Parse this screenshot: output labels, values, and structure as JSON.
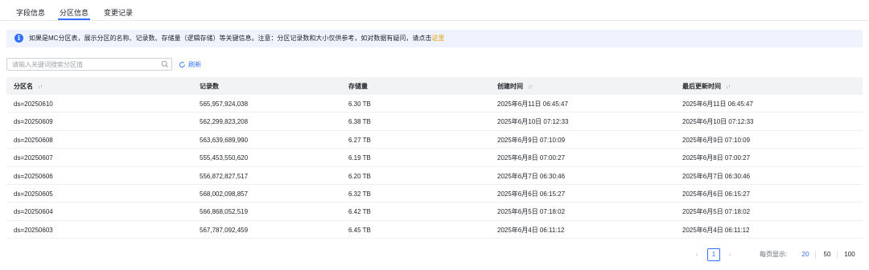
{
  "tabs": [
    {
      "label": "字段信息"
    },
    {
      "label": "分区信息"
    },
    {
      "label": "变更记录"
    }
  ],
  "notice": {
    "icon": "info-icon",
    "text": "如果是MC分区表，展示分区的名称、记录数、存储量（逻辑存储）等关键信息。注意：分区记录数和大小仅供参考，如对数据有疑问，请点击",
    "link": "这里"
  },
  "search": {
    "placeholder": "请输入关键词搜索分区值",
    "value": ""
  },
  "refresh_label": "刷新",
  "table": {
    "columns": [
      "分区名",
      "记录数",
      "存储量",
      "创建时间",
      "最后更新时间"
    ],
    "rows": [
      [
        "ds=20250610",
        "565,957,924,038",
        "6.30 TB",
        "2025年6月11日 06:45:47",
        "2025年6月11日 06:45:47"
      ],
      [
        "ds=20250609",
        "562,299,823,208",
        "6.38 TB",
        "2025年6月10日 07:12:33",
        "2025年6月10日 07:12:33"
      ],
      [
        "ds=20250608",
        "563,639,689,990",
        "6.27 TB",
        "2025年6月9日 07:10:09",
        "2025年6月9日 07:10:09"
      ],
      [
        "ds=20250607",
        "555,453,550,620",
        "6.19 TB",
        "2025年6月8日 07:00:27",
        "2025年6月8日 07:00:27"
      ],
      [
        "ds=20250606",
        "556,872,827,517",
        "6.20 TB",
        "2025年6月7日 06:30:46",
        "2025年6月7日 06:30:46"
      ],
      [
        "ds=20250605",
        "568,002,098,857",
        "6.32 TB",
        "2025年6月6日 06:15:27",
        "2025年6月6日 06:15:27"
      ],
      [
        "ds=20250604",
        "566,868,052,519",
        "6.42 TB",
        "2025年6月5日 07:18:02",
        "2025年6月5日 07:18:02"
      ],
      [
        "ds=20250603",
        "567,787,092,459",
        "6.45 TB",
        "2025年6月4日 06:11:12",
        "2025年6月4日 06:11:12"
      ]
    ]
  },
  "pagination": {
    "prev": "‹",
    "current_page": "1",
    "next": "›",
    "page_size_label": "每页显示:",
    "page_size_options": [
      "20",
      "50",
      "100"
    ],
    "selected_page_size": "20"
  },
  "colors": {
    "accent": "#3370ff",
    "link": "#e3a008",
    "notice_bg": "#eef3fe"
  }
}
